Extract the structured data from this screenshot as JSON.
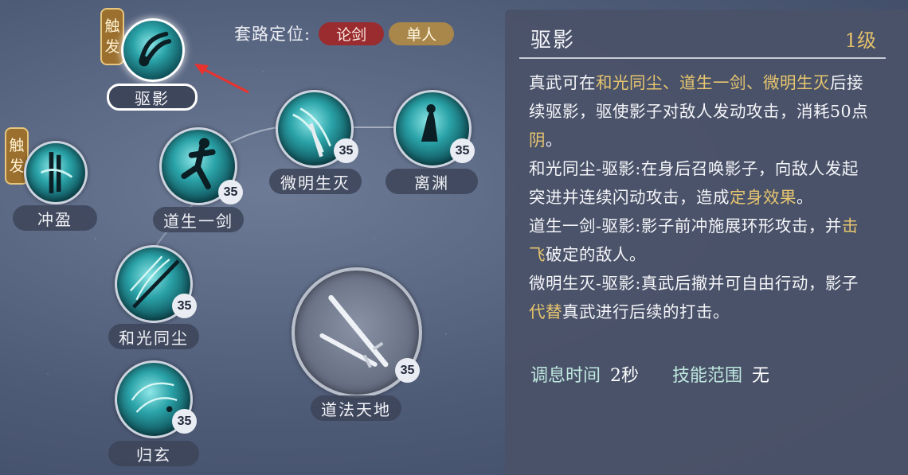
{
  "route": {
    "label": "套路定位:",
    "tags": [
      "论剑",
      "单人"
    ]
  },
  "trigger_text": "触发",
  "skills": {
    "quying": {
      "name": "驱影"
    },
    "chongying": {
      "name": "冲盈"
    },
    "daosheng": {
      "name": "道生一剑",
      "level": "35"
    },
    "weiming": {
      "name": "微明生灭",
      "level": "35"
    },
    "liyuan": {
      "name": "离渊",
      "level": "35"
    },
    "heguang": {
      "name": "和光同尘",
      "level": "35"
    },
    "guixuan": {
      "name": "归玄",
      "level": "35"
    },
    "daofa": {
      "name": "道法天地",
      "level": "35"
    }
  },
  "panel": {
    "title": "驱影",
    "level": "1级",
    "p1": {
      "a": "真武可在",
      "b": "和光同尘、道生一剑、微明生灭",
      "c": "后接续驱影，驱使影子对敌人发动攻击，消耗50点",
      "d": "阴",
      "e": "。"
    },
    "p2": {
      "a": "和光同尘-驱影:在身后召唤影子，向敌人发起突进并连续闪动攻击，造成",
      "b": "定身效果",
      "c": "。"
    },
    "p3": {
      "a": "道生一剑-驱影:影子前冲施展环形攻击，并",
      "b": "击飞",
      "c": "破定的敌人。"
    },
    "p4": {
      "a": "微明生灭-驱影:真武后撤并可自由行动，影子",
      "b": "代替",
      "c": "真武进行后续的打击。"
    },
    "cooldown_label": "调息时间",
    "cooldown_value": "2秒",
    "range_label": "技能范围",
    "range_value": "无"
  },
  "colors": {
    "highlight": "#e7c66f",
    "tag_red": "#9a2b2e",
    "tag_gold": "#a9874a"
  }
}
